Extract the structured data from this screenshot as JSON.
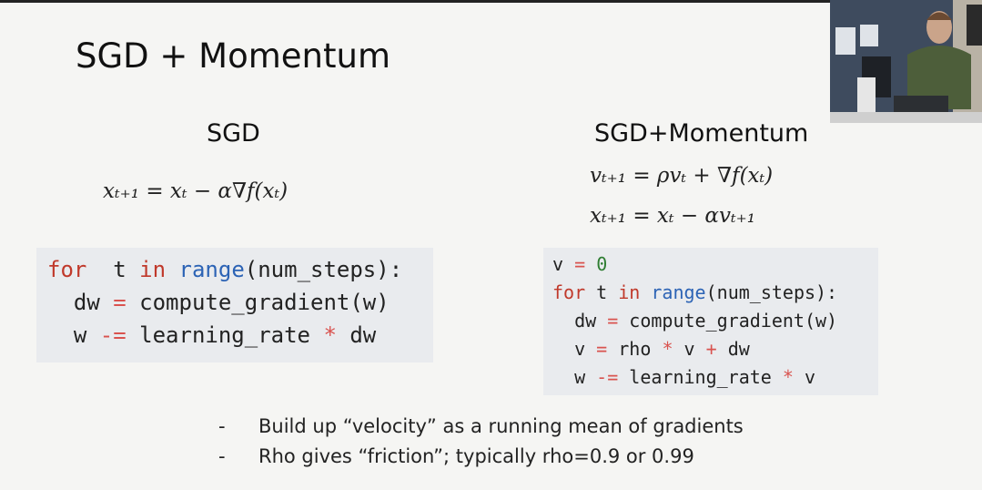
{
  "slide": {
    "title": "SGD + Momentum",
    "left": {
      "heading": "SGD",
      "equations": [
        "xₜ₊₁ = xₜ − α∇f(xₜ)"
      ],
      "code": [
        [
          [
            "kw",
            "for"
          ],
          [
            "",
            "  t "
          ],
          [
            "kw",
            "in"
          ],
          [
            "",
            " "
          ],
          [
            "bi",
            "range"
          ],
          [
            "",
            "(num_steps):"
          ]
        ],
        [
          [
            "",
            "  dw "
          ],
          [
            "op",
            "="
          ],
          [
            "",
            " compute_gradient(w)"
          ]
        ],
        [
          [
            "",
            "  w "
          ],
          [
            "op",
            "-="
          ],
          [
            "",
            " learning_rate "
          ],
          [
            "op",
            "*"
          ],
          [
            "",
            " dw"
          ]
        ]
      ]
    },
    "right": {
      "heading": "SGD+Momentum",
      "equations": [
        "vₜ₊₁ = ρvₜ + ∇f(xₜ)",
        "xₜ₊₁ = xₜ − αvₜ₊₁"
      ],
      "code": [
        [
          [
            "",
            "v "
          ],
          [
            "op",
            "="
          ],
          [
            "",
            " "
          ],
          [
            "num",
            "0"
          ]
        ],
        [
          [
            "kw",
            "for"
          ],
          [
            "",
            " t "
          ],
          [
            "kw",
            "in"
          ],
          [
            "",
            " "
          ],
          [
            "bi",
            "range"
          ],
          [
            "",
            "(num_steps):"
          ]
        ],
        [
          [
            "",
            "  dw "
          ],
          [
            "op",
            "="
          ],
          [
            "",
            " compute_gradient(w)"
          ]
        ],
        [
          [
            "",
            "  v "
          ],
          [
            "op",
            "="
          ],
          [
            "",
            " rho "
          ],
          [
            "op",
            "*"
          ],
          [
            "",
            " v "
          ],
          [
            "op",
            "+"
          ],
          [
            "",
            " dw"
          ]
        ],
        [
          [
            "",
            "  w "
          ],
          [
            "op",
            "-="
          ],
          [
            "",
            " learning_rate "
          ],
          [
            "op",
            "*"
          ],
          [
            "",
            " v"
          ]
        ]
      ]
    },
    "bullets": [
      {
        "marker": "-",
        "text": "Build up “velocity” as a running mean of gradients"
      },
      {
        "marker": "-",
        "text": "Rho gives “friction”; typically rho=0.9 or 0.99"
      }
    ]
  }
}
